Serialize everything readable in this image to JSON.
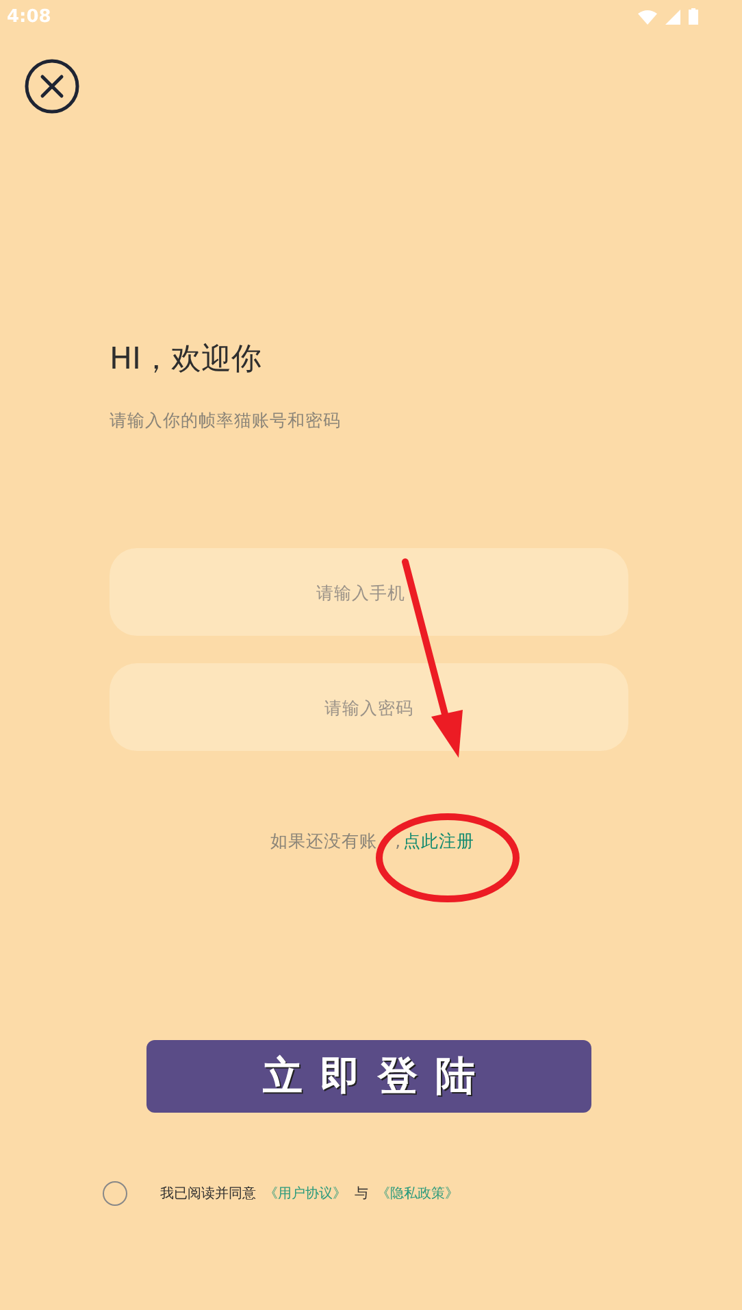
{
  "status_bar": {
    "time": "4:08"
  },
  "title": "HI，欢迎你",
  "subtitle": "请输入你的帧率猫账号和密码",
  "fields": [
    {
      "placeholder": "请输入手机"
    },
    {
      "placeholder": "请输入密码"
    }
  ],
  "register": {
    "prompt": "如果还没有账",
    "separator": ",",
    "link": "点此注册"
  },
  "login_button": "立即登陆",
  "agreement": {
    "checked": false,
    "text": "我已阅读并同意",
    "terms_link": "《用户协议》",
    "joiner": "与",
    "privacy_link": "《隐私政策》"
  }
}
